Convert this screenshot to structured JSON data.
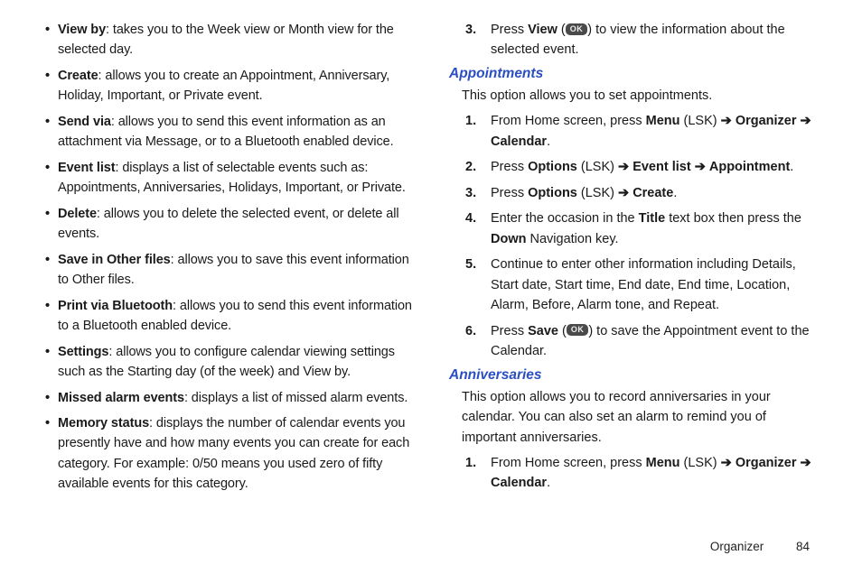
{
  "left_bullets": [
    {
      "label": "View by",
      "desc": ": takes you to the Week view or Month view for the selected day."
    },
    {
      "label": "Create",
      "desc": ": allows you to create an Appointment, Anniversary, Holiday, Important, or Private event."
    },
    {
      "label": "Send via",
      "desc": ": allows you to send this event information as an attachment via Message, or to a Bluetooth enabled device."
    },
    {
      "label": "Event list",
      "desc": ": displays a list of selectable events such as: Appointments, Anniversaries, Holidays, Important, or Private."
    },
    {
      "label": "Delete",
      "desc": ": allows you to delete the selected event, or delete all events."
    },
    {
      "label": "Save in Other files",
      "desc": ": allows you to save this event information to Other files."
    },
    {
      "label": "Print via Bluetooth",
      "desc": ": allows you to send this event information to a Bluetooth enabled device."
    },
    {
      "label": "Settings",
      "desc": ": allows you to configure calendar viewing settings such as the Starting day (of the week) and View by."
    },
    {
      "label": "Missed alarm events",
      "desc": ": displays a list of missed alarm events."
    },
    {
      "label": "Memory status",
      "desc": ": displays the number of calendar events you presently have and how many events you can create for each category. For example: 0/50 means you used zero of fifty available events for this category."
    }
  ],
  "right": {
    "step3": {
      "num": "3.",
      "pre": "Press ",
      "view": "View",
      "mid": " (",
      "ok": "OK",
      "post": ") to view the information about the selected event."
    },
    "appointments": {
      "heading": "Appointments",
      "intro": "This option allows you to set appointments.",
      "steps": [
        {
          "num": "1.",
          "parts": [
            {
              "t": "From Home screen, press "
            },
            {
              "t": "Menu",
              "b": true
            },
            {
              "t": " (LSK) "
            },
            {
              "t": "➔",
              "a": true
            },
            {
              "t": " "
            },
            {
              "t": "Organizer",
              "b": true
            },
            {
              "t": " "
            },
            {
              "t": "➔",
              "a": true
            },
            {
              "t": " "
            },
            {
              "t": "Calendar",
              "b": true
            },
            {
              "t": "."
            }
          ]
        },
        {
          "num": "2.",
          "parts": [
            {
              "t": "Press "
            },
            {
              "t": "Options",
              "b": true
            },
            {
              "t": " (LSK) "
            },
            {
              "t": "➔",
              "a": true
            },
            {
              "t": " "
            },
            {
              "t": "Event list",
              "b": true
            },
            {
              "t": " "
            },
            {
              "t": "➔",
              "a": true
            },
            {
              "t": " "
            },
            {
              "t": "Appointment",
              "b": true
            },
            {
              "t": "."
            }
          ]
        },
        {
          "num": "3.",
          "parts": [
            {
              "t": "Press "
            },
            {
              "t": "Options",
              "b": true
            },
            {
              "t": " (LSK) "
            },
            {
              "t": "➔",
              "a": true
            },
            {
              "t": " "
            },
            {
              "t": "Create",
              "b": true
            },
            {
              "t": "."
            }
          ]
        },
        {
          "num": "4.",
          "parts": [
            {
              "t": "Enter the occasion in the "
            },
            {
              "t": "Title",
              "b": true
            },
            {
              "t": " text box then press the "
            },
            {
              "t": "Down",
              "b": true
            },
            {
              "t": " Navigation key."
            }
          ]
        },
        {
          "num": "5.",
          "parts": [
            {
              "t": "Continue to enter other information including Details, Start date, Start time, End date, End time, Location, Alarm, Before, Alarm tone, and Repeat."
            }
          ]
        },
        {
          "num": "6.",
          "ok_step": true,
          "pre": "Press ",
          "save": "Save",
          "mid": " (",
          "ok": "OK",
          "post": ") to save the Appointment event to the Calendar."
        }
      ]
    },
    "anniversaries": {
      "heading": "Anniversaries",
      "intro": "This option allows you to record anniversaries in your calendar. You can also set an alarm to remind you of important anniversaries.",
      "steps": [
        {
          "num": "1.",
          "parts": [
            {
              "t": "From Home screen, press "
            },
            {
              "t": "Menu",
              "b": true
            },
            {
              "t": " (LSK) "
            },
            {
              "t": "➔",
              "a": true
            },
            {
              "t": " "
            },
            {
              "t": "Organizer",
              "b": true
            },
            {
              "t": " "
            },
            {
              "t": "➔",
              "a": true
            },
            {
              "t": " "
            },
            {
              "t": "Calendar",
              "b": true
            },
            {
              "t": "."
            }
          ]
        }
      ]
    }
  },
  "footer": {
    "section": "Organizer",
    "page": "84"
  }
}
